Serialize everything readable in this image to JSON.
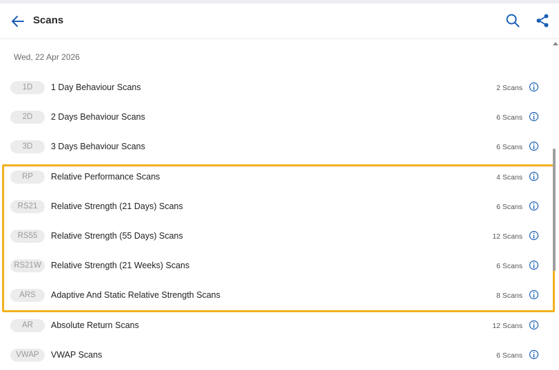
{
  "header": {
    "title": "Scans"
  },
  "date_label": "Wed, 22 Apr 2026",
  "colors": {
    "accent": "#1a5fb4",
    "highlight_border": "#f2b01e",
    "pill_bg": "#ececec"
  },
  "scans": [
    {
      "code": "1D",
      "name": "1 Day Behaviour Scans",
      "count": "2 Scans"
    },
    {
      "code": "2D",
      "name": "2 Days Behaviour Scans",
      "count": "6 Scans"
    },
    {
      "code": "3D",
      "name": "3 Days Behaviour Scans",
      "count": "6 Scans"
    },
    {
      "code": "RP",
      "name": "Relative Performance Scans",
      "count": "4 Scans"
    },
    {
      "code": "RS21",
      "name": "Relative Strength (21 Days) Scans",
      "count": "6 Scans"
    },
    {
      "code": "RS55",
      "name": "Relative Strength (55 Days) Scans",
      "count": "12 Scans"
    },
    {
      "code": "RS21W",
      "name": "Relative Strength (21 Weeks) Scans",
      "count": "6 Scans"
    },
    {
      "code": "ARS",
      "name": "Adaptive And Static Relative Strength Scans",
      "count": "8 Scans"
    },
    {
      "code": "AR",
      "name": "Absolute Return Scans",
      "count": "12 Scans"
    },
    {
      "code": "VWAP",
      "name": "VWAP Scans",
      "count": "6 Scans"
    }
  ]
}
